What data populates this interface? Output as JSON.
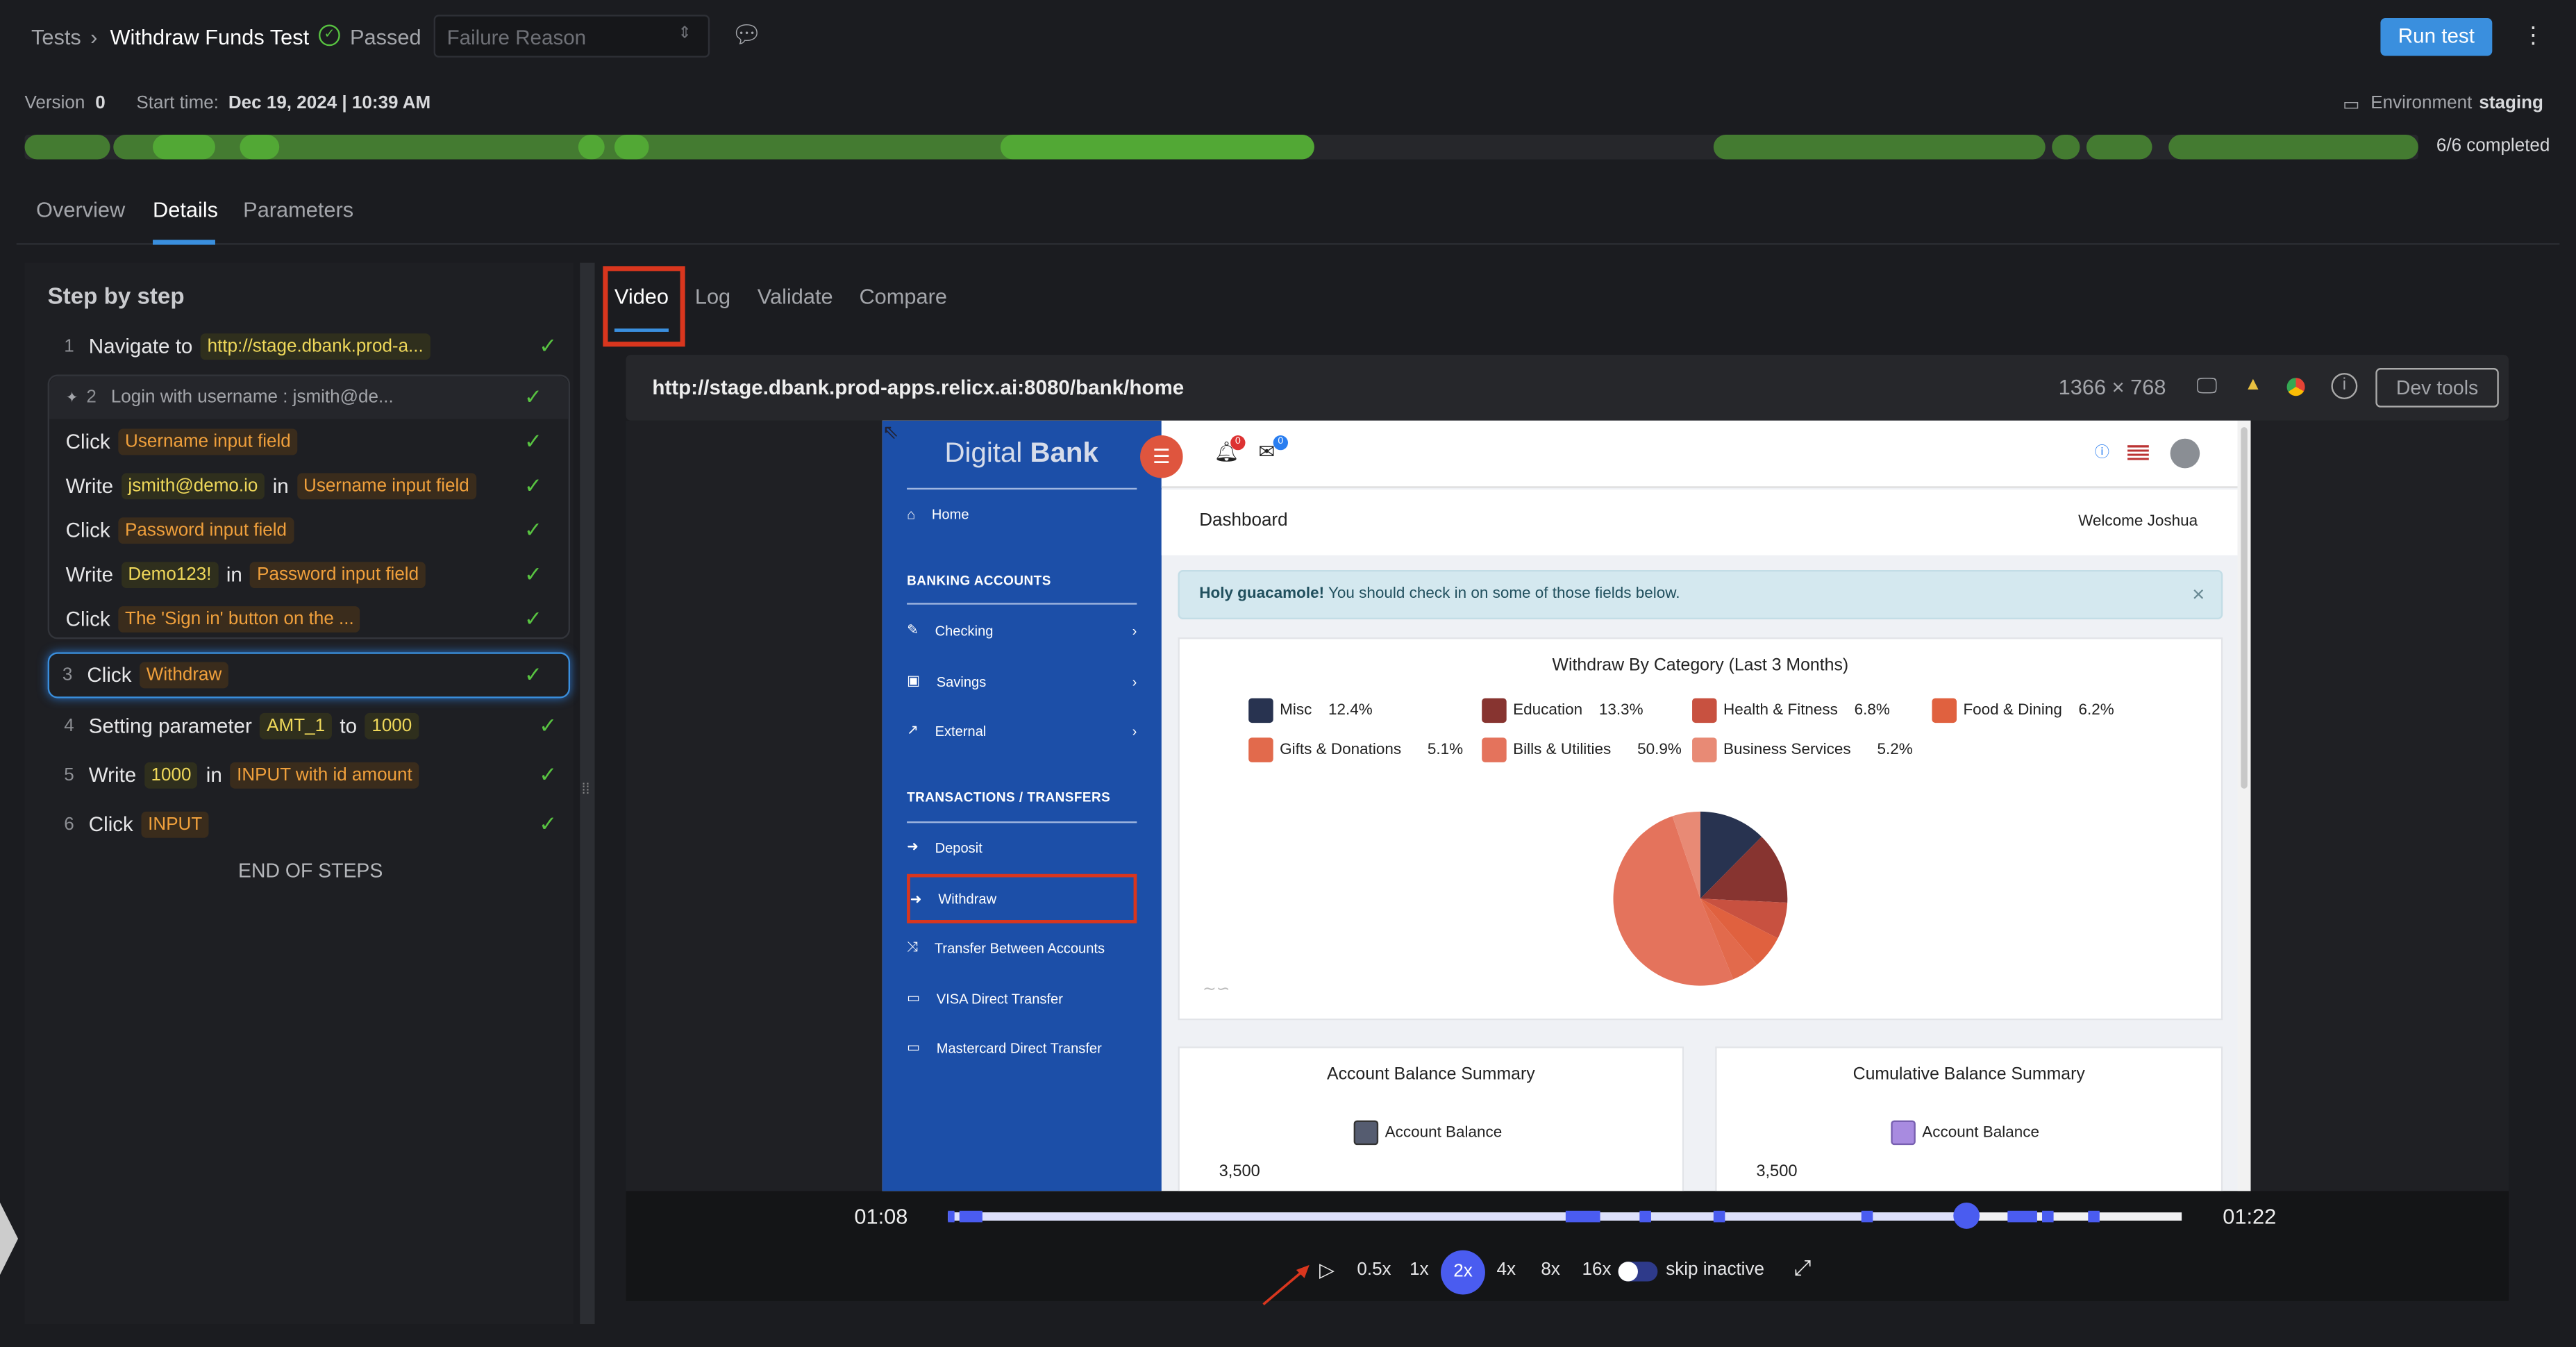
{
  "header": {
    "breadcrumb_root": "Tests",
    "test_name": "Withdraw Funds Test",
    "status": "Passed",
    "failure_reason_placeholder": "Failure Reason",
    "run_test_label": "Run test",
    "comment_icon": "speech-bubble-icon",
    "more_icon": "vertical-dots-icon"
  },
  "meta": {
    "version_label": "Version",
    "version_value": "0",
    "start_label": "Start time:",
    "start_value": "Dec 19, 2024 | 10:39 AM",
    "env_label": "Environment",
    "env_value": "staging",
    "completed": "6/6 completed",
    "progress_steps_done": 6,
    "progress_steps_total": 6
  },
  "tabs": [
    "Overview",
    "Details",
    "Parameters"
  ],
  "active_tab": "Details",
  "steps": {
    "title": "Step by step",
    "s1": {
      "num": "1",
      "action": "Navigate to",
      "value": "http://stage.dbank.prod-a..."
    },
    "s2": {
      "num": "2",
      "title": "Login with username : jsmith@de...",
      "sub": [
        {
          "action": "Click",
          "target": "Username input field"
        },
        {
          "action": "Write",
          "value": "jsmith@demo.io",
          "in": "in",
          "target": "Username input field"
        },
        {
          "action": "Click",
          "target": "Password input field"
        },
        {
          "action": "Write",
          "value": "Demo123!",
          "in": "in",
          "target": "Password input field"
        },
        {
          "action": "Click",
          "target": "The 'Sign in' button on the ..."
        }
      ]
    },
    "s3": {
      "num": "3",
      "action": "Click",
      "target": "Withdraw"
    },
    "s4": {
      "num": "4",
      "action": "Setting parameter",
      "value": "AMT_1",
      "to": "to",
      "value2": "1000"
    },
    "s5": {
      "num": "5",
      "action": "Write",
      "value": "1000",
      "in": "in",
      "target": "INPUT with id amount"
    },
    "s6": {
      "num": "6",
      "action": "Click",
      "target": "INPUT"
    },
    "end": "END OF STEPS"
  },
  "viewer": {
    "tabs": [
      "Video",
      "Log",
      "Validate",
      "Compare"
    ],
    "active": "Video",
    "url": "http://stage.dbank.prod-apps.relicx.ai:8080/bank/home",
    "resolution": "1366 × 768",
    "devtools": "Dev tools"
  },
  "bank": {
    "brand_light": "Digital",
    "brand_bold": "Bank",
    "bell_count": "0",
    "mail_count": "0",
    "nav": {
      "home": "Home",
      "h1": "BANKING ACCOUNTS",
      "checking": "Checking",
      "savings": "Savings",
      "external": "External",
      "h2": "TRANSACTIONS / TRANSFERS",
      "deposit": "Deposit",
      "withdraw": "Withdraw",
      "transfer": "Transfer Between Accounts",
      "visa": "VISA Direct Transfer",
      "mastercard": "Mastercard Direct Transfer"
    },
    "dashboard": "Dashboard",
    "welcome": "Welcome Joshua",
    "alert_bold": "Holy guacamole!",
    "alert_text": "You should check in on some of those fields below.",
    "alert_close": "×",
    "card1_title": "Account Balance Summary",
    "card1_legend": "Account Balance",
    "card1_tick": "3,500",
    "card2_title": "Cumulative Balance Summary",
    "card2_legend": "Account Balance",
    "card2_tick": "3,500"
  },
  "chart_data": {
    "type": "pie",
    "title": "Withdraw By Category (Last 3 Months)",
    "legend": "top",
    "categories": [
      "Misc",
      "Education",
      "Health & Fitness",
      "Food & Dining",
      "Gifts & Donations",
      "Bills & Utilities",
      "Business Services"
    ],
    "labels": [
      "12.4%",
      "13.3%",
      "6.8%",
      "6.2%",
      "5.1%",
      "50.9%",
      "5.2%"
    ],
    "values": [
      12.4,
      13.3,
      6.8,
      6.2,
      5.1,
      50.9,
      5.2
    ],
    "colors": [
      "#283350",
      "#873430",
      "#c85140",
      "#e0613f",
      "#e26a4c",
      "#e4735c",
      "#e88a75"
    ]
  },
  "player": {
    "current": "01:08",
    "end": "01:22",
    "progress": 0.826,
    "speeds": [
      "0.5x",
      "1x",
      "2x",
      "4x",
      "8x",
      "16x"
    ],
    "active_speed": "2x",
    "skip_label": "skip inactive",
    "skip_on": true,
    "accent": "#4a5cf0"
  }
}
